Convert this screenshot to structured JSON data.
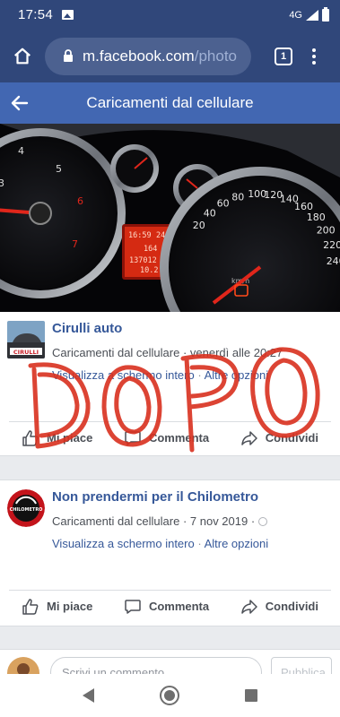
{
  "status_bar": {
    "time": "17:54",
    "network": "4G"
  },
  "browser": {
    "url_host": "m.facebook.com",
    "url_path": "/photo",
    "tab_count": "1"
  },
  "header": {
    "title": "Caricamenti dal cellulare"
  },
  "photo": {
    "clock": "16:59",
    "temperature": "24°C",
    "trip_distance": "164 km",
    "odometer": "137012 km",
    "secondary_trip": "10.2 km",
    "speed_labels": [
      "20",
      "40",
      "60",
      "80",
      "100",
      "120",
      "140",
      "160",
      "180",
      "200",
      "220",
      "240"
    ],
    "speed_unit": "km/h"
  },
  "overlay": {
    "handwritten_text": "DOPO",
    "color": "#d9301f"
  },
  "posts": [
    {
      "author": "Cirulli auto",
      "avatar_text": "CIRULLI",
      "meta": "Caricamenti dal cellulare · venerdì alle 20:27",
      "links": [
        "Visualizza a schermo intero",
        "Altre opzioni"
      ],
      "actions": [
        "Mi piace",
        "Commenta",
        "Condividi"
      ]
    },
    {
      "author": "Non prendermi per il Chilometro",
      "avatar_text": "CHILOMETRO",
      "meta": "Caricamenti dal cellulare · 7 nov 2019 ·",
      "links": [
        "Visualizza a schermo intero",
        "Altre opzioni"
      ],
      "actions": [
        "Mi piace",
        "Commenta",
        "Condividi"
      ]
    }
  ],
  "comment_bar": {
    "placeholder": "Scrivi un commento...",
    "post_label": "Pubblica"
  },
  "colors": {
    "chrome": "#30477a",
    "facebook_blue": "#4267b2",
    "link": "#365899"
  },
  "icons": [
    "image-icon",
    "signal-icon",
    "battery-icon",
    "home-icon",
    "lock-icon",
    "tabs-icon",
    "more-icon",
    "back-arrow-icon",
    "like-icon",
    "comment-icon",
    "share-icon",
    "globe-icon"
  ]
}
